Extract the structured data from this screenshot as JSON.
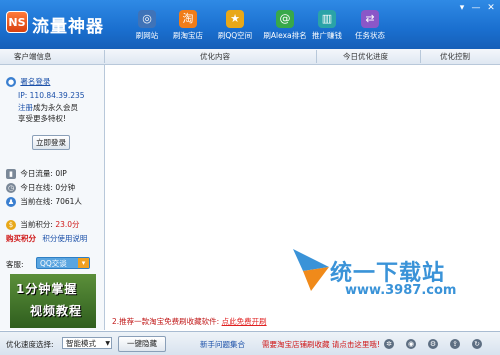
{
  "app": {
    "title": "流量神器",
    "logo": "NS"
  },
  "window_controls": {
    "menu": "▾",
    "minimize": "—",
    "close": "✕"
  },
  "nav": [
    {
      "label": "刷网站",
      "icon": "globe-icon",
      "glyph": "◎",
      "color": "#3f73b8"
    },
    {
      "label": "刷淘宝店",
      "icon": "taobao-icon",
      "glyph": "淘",
      "color": "#f07d1a"
    },
    {
      "label": "刷QQ空间",
      "icon": "star-icon",
      "glyph": "★",
      "color": "#e8a818"
    },
    {
      "label": "刷Alexa排名",
      "icon": "alexa-icon",
      "glyph": "@",
      "color": "#38a84a"
    },
    {
      "label": "推广赚钱",
      "icon": "chart-icon",
      "glyph": "▥",
      "color": "#2aa3a8"
    },
    {
      "label": "任务状态",
      "icon": "swap-icon",
      "glyph": "⇄",
      "color": "#8a57c8"
    }
  ],
  "columns": {
    "client": "客户端信息",
    "content": "优化内容",
    "progress": "今日优化进度",
    "control": "优化控制"
  },
  "sidebar": {
    "login_link": "署名登录",
    "ip_label": "IP:",
    "ip_value": "110.84.39.235",
    "register_link": "注册",
    "register_text": "成为永久会员",
    "register_sub": "享受更多特权!",
    "login_button": "立即登录",
    "traffic_label": "今日流量:",
    "traffic_value": "0IP",
    "online_label": "今日在线:",
    "online_value": "0分钟",
    "users_label": "当前在线:",
    "users_value": "7061人",
    "points_label": "当前积分:",
    "points_value": "23.0分",
    "buy_points": "购买积分",
    "points_help": "积分使用说明",
    "service_label": "客服:",
    "qq_label": "QQ交谈",
    "video_line1": "1分钟掌握",
    "video_line2": "视频教程"
  },
  "main": {
    "notice_text": "2.推荐一款淘宝免费刷收藏软件:",
    "notice_link": "点此免费开刷"
  },
  "watermark": {
    "text": "统一下载站",
    "url": "www.3987.com"
  },
  "statusbar": {
    "mode_label": "优化速度选择:",
    "mode_value": "智能模式",
    "hide_button": "一键隐藏",
    "faq": "新手问题集合",
    "taobao_notice": "需要淘宝店铺刷收藏 请点击这里哦!",
    "faq_color": "#1a4fa8",
    "notice_color": "#d01818"
  }
}
